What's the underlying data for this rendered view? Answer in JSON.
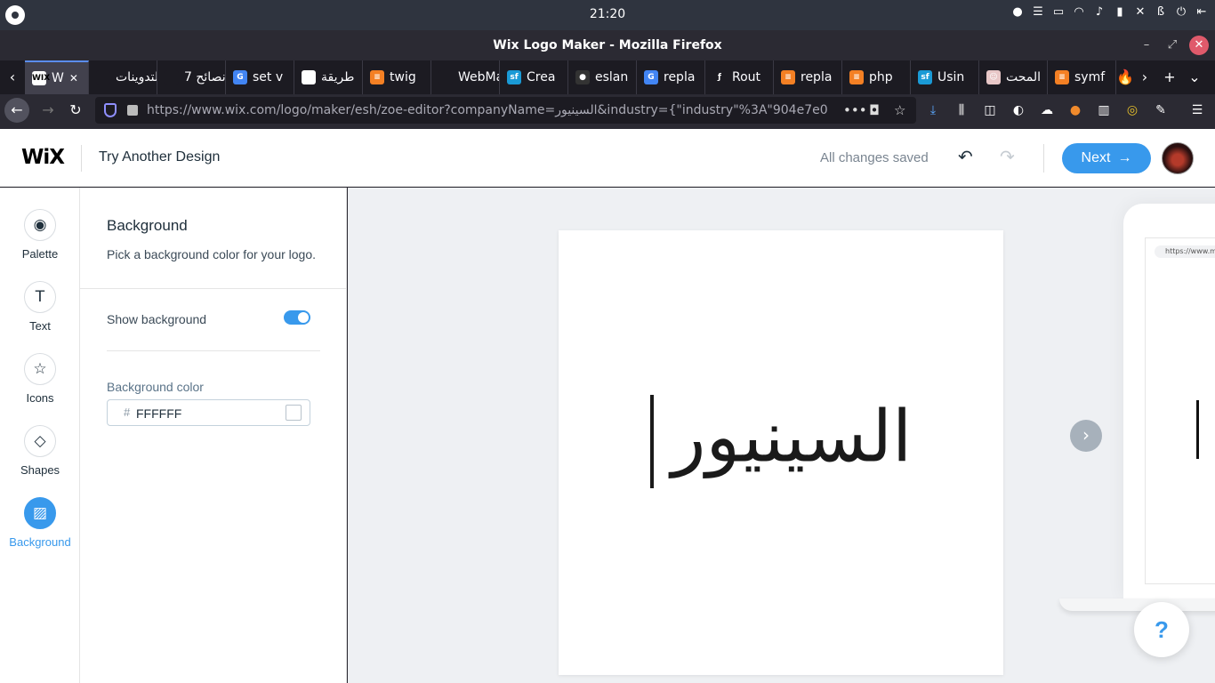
{
  "os": {
    "clock": "21:20"
  },
  "window": {
    "title": "Wix Logo Maker - Mozilla Firefox"
  },
  "tabs": [
    {
      "label": "W",
      "favicon": "WIX",
      "color": "#ffffff",
      "active": true
    },
    {
      "label": "التدوينات",
      "favicon": "",
      "color": "#1c1b22"
    },
    {
      "label": "7 نصائح",
      "favicon": "",
      "color": "#1c1b22"
    },
    {
      "label": "set v",
      "favicon": "G",
      "color": "#4285f4"
    },
    {
      "label": "طريقة",
      "favicon": "⚑",
      "color": "#ffffff"
    },
    {
      "label": "twig",
      "favicon": "≡",
      "color": "#f48024"
    },
    {
      "label": "WebMa",
      "favicon": "",
      "color": "#1c1b22"
    },
    {
      "label": "Crea",
      "favicon": "sf",
      "color": "#1a9ad6"
    },
    {
      "label": "eslan",
      "favicon": "●",
      "color": "#333333"
    },
    {
      "label": "repla",
      "favicon": "G",
      "color": "#4285f4"
    },
    {
      "label": "Rout",
      "favicon": "ƒ",
      "color": "#1c1b22"
    },
    {
      "label": "repla",
      "favicon": "≡",
      "color": "#f48024"
    },
    {
      "label": "php",
      "favicon": "≡",
      "color": "#f48024"
    },
    {
      "label": "Usin",
      "favicon": "sf",
      "color": "#1a9ad6"
    },
    {
      "label": "المحت",
      "favicon": "☺",
      "color": "#e8c7c7"
    },
    {
      "label": "symf",
      "favicon": "≡",
      "color": "#f48024"
    }
  ],
  "nav": {
    "url": "https://www.wix.com/logo/maker/esh/zoe-editor?companyName=السينيور&industry={\"industry\"%3A\"904e7e0"
  },
  "header": {
    "logo": "WiX",
    "try_another": "Try Another Design",
    "saved_status": "All changes saved",
    "next_label": "Next"
  },
  "rail": [
    {
      "label": "Palette",
      "icon": "palette-icon",
      "glyph": "◉"
    },
    {
      "label": "Text",
      "icon": "text-icon",
      "glyph": "T"
    },
    {
      "label": "Icons",
      "icon": "star-icon",
      "glyph": "☆"
    },
    {
      "label": "Shapes",
      "icon": "shapes-icon",
      "glyph": "◇"
    },
    {
      "label": "Background",
      "icon": "background-icon",
      "glyph": "▨",
      "active": true
    }
  ],
  "panel": {
    "title": "Background",
    "description": "Pick a background color for your logo.",
    "show_background_label": "Show background",
    "show_background_on": true,
    "bg_color_label": "Background color",
    "hash": "#",
    "bg_color_value": "FFFFFF"
  },
  "canvas": {
    "logo_text": "السينيور",
    "mockup_url": "https://www.m",
    "help": "?"
  },
  "colors": {
    "accent": "#3899ec",
    "text": "#20303c"
  }
}
